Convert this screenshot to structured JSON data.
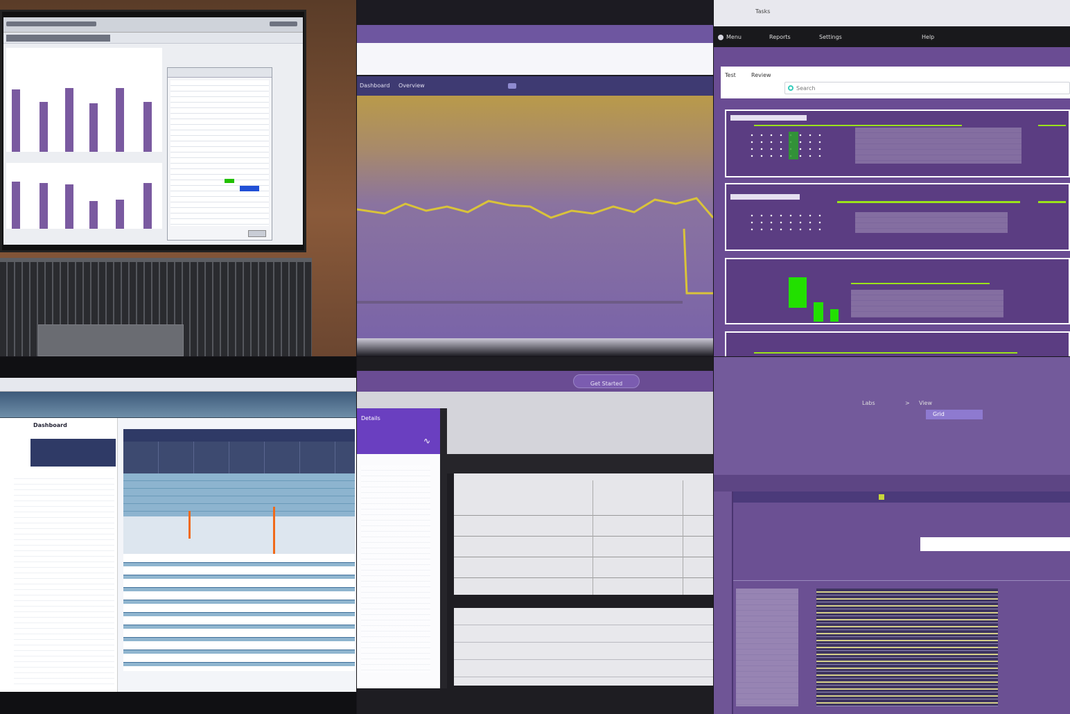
{
  "tile_laptop": {
    "toolbar_text": "",
    "panel_footer": ""
  },
  "tile_wave": {
    "breadcrumb": [
      "Dashboard",
      "Overview"
    ]
  },
  "tile_cards": {
    "title": "Tasks",
    "nav": [
      "Menu",
      "Reports",
      "Settings",
      "Help"
    ],
    "tabs": [
      "Test",
      "Review"
    ],
    "search_hint": "Search"
  },
  "tile_table": {
    "heading": "Dashboard"
  },
  "tile_overlay": {
    "header_button": "Get Started",
    "panel_title": "Details"
  },
  "tile_list": {
    "breadcrumb": [
      "Labs",
      "View"
    ],
    "tab_active": "Grid"
  },
  "colors": {
    "purple": "#6a4c93",
    "lime": "#9be31a",
    "green": "#22e000",
    "orange": "#f06a1a",
    "navy": "#2f3a66"
  }
}
